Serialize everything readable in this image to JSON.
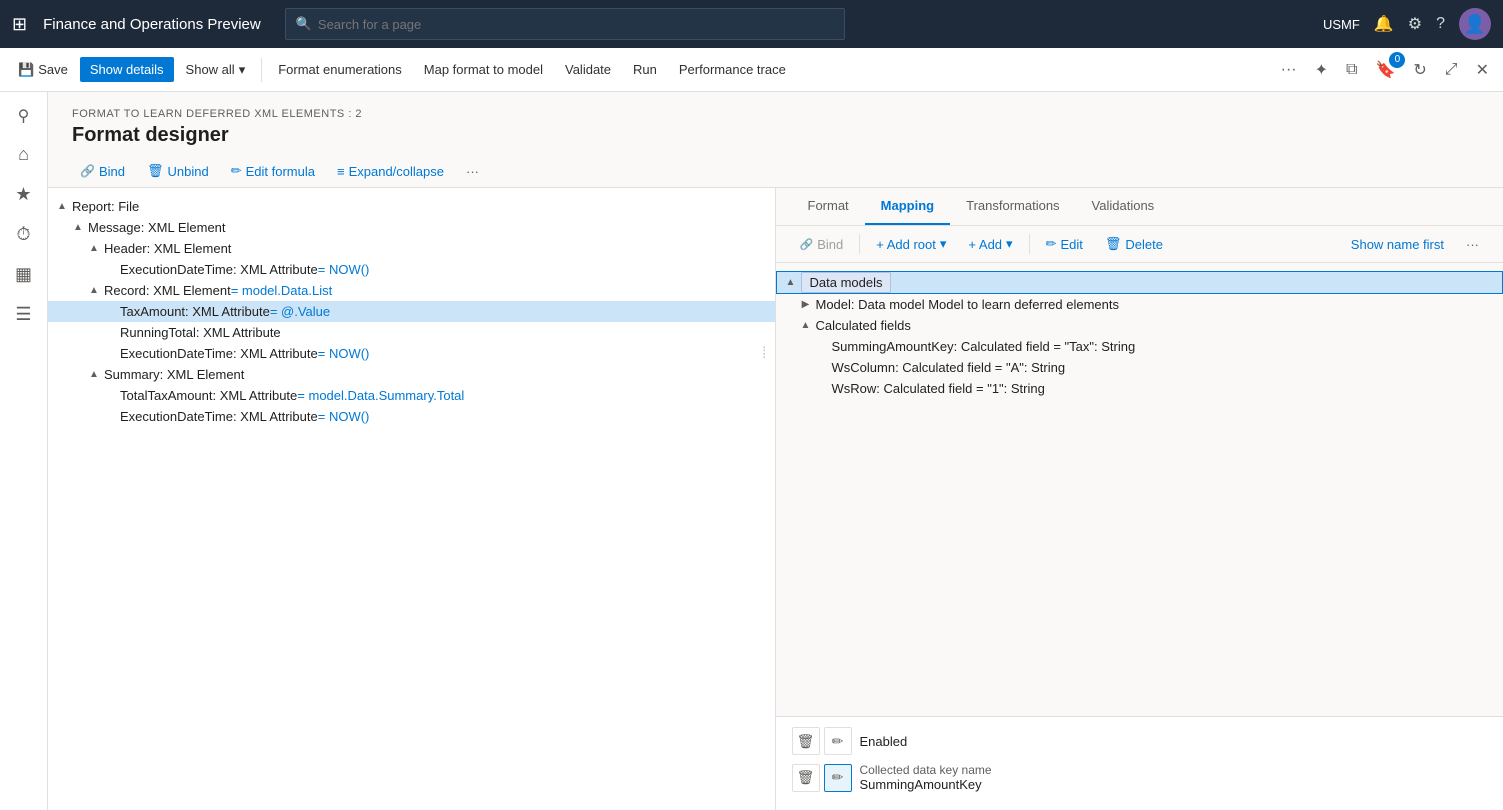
{
  "topNav": {
    "gridIcon": "⊞",
    "appTitle": "Finance and Operations Preview",
    "searchPlaceholder": "Search for a page",
    "searchIcon": "🔍",
    "username": "USMF",
    "bellIcon": "🔔",
    "gearIcon": "⚙",
    "helpIcon": "?",
    "avatarInitial": "👤"
  },
  "toolbar": {
    "saveLabel": "Save",
    "showDetailsLabel": "Show details",
    "showAllLabel": "Show all",
    "showAllDropdown": "▾",
    "formatEnumerationsLabel": "Format enumerations",
    "mapFormatToModelLabel": "Map format to model",
    "validateLabel": "Validate",
    "runLabel": "Run",
    "performanceTraceLabel": "Performance trace",
    "moreIcon": "···",
    "pinIcon": "📌",
    "copyIcon": "⧉",
    "badgeCount": "0",
    "refreshIcon": "↻",
    "popoutIcon": "⤢",
    "closeIcon": "✕"
  },
  "sidebar": {
    "items": [
      {
        "icon": "☰",
        "name": "menu-icon"
      },
      {
        "icon": "⌂",
        "name": "home-icon"
      },
      {
        "icon": "★",
        "name": "favorites-icon"
      },
      {
        "icon": "⏱",
        "name": "recent-icon"
      },
      {
        "icon": "▦",
        "name": "workspaces-icon"
      },
      {
        "icon": "☰",
        "name": "modules-icon"
      }
    ]
  },
  "pageHeader": {
    "breadcrumb": "FORMAT TO LEARN DEFERRED XML ELEMENTS : 2",
    "title": "Format designer"
  },
  "subToolbar": {
    "bindLabel": "Bind",
    "unbindLabel": "Unbind",
    "editFormulaLabel": "Edit formula",
    "expandCollapseLabel": "Expand/collapse",
    "moreIcon": "···"
  },
  "formatTree": {
    "items": [
      {
        "indent": 0,
        "toggle": "▲",
        "label": "Report: File",
        "selected": false
      },
      {
        "indent": 1,
        "toggle": "▲",
        "label": "Message: XML Element",
        "selected": false
      },
      {
        "indent": 2,
        "toggle": "▲",
        "label": "Header: XML Element",
        "selected": false
      },
      {
        "indent": 3,
        "toggle": "",
        "label": "ExecutionDateTime: XML Attribute",
        "formula": " = NOW()",
        "selected": false
      },
      {
        "indent": 2,
        "toggle": "▲",
        "label": "Record: XML Element",
        "formula": " = model.Data.List",
        "selected": false
      },
      {
        "indent": 3,
        "toggle": "",
        "label": "TaxAmount: XML Attribute",
        "formula": " = @.Value",
        "selected": true
      },
      {
        "indent": 3,
        "toggle": "",
        "label": "RunningTotal: XML Attribute",
        "selected": false
      },
      {
        "indent": 3,
        "toggle": "",
        "label": "ExecutionDateTime: XML Attribute",
        "formula": " = NOW()",
        "selected": false,
        "hasHandle": true
      },
      {
        "indent": 2,
        "toggle": "▲",
        "label": "Summary: XML Element",
        "selected": false
      },
      {
        "indent": 3,
        "toggle": "",
        "label": "TotalTaxAmount: XML Attribute",
        "formula": " = model.Data.Summary.Total",
        "selected": false
      },
      {
        "indent": 3,
        "toggle": "",
        "label": "ExecutionDateTime: XML Attribute",
        "formula": " = NOW()",
        "selected": false
      }
    ]
  },
  "rightPanel": {
    "tabs": [
      {
        "label": "Format",
        "active": false
      },
      {
        "label": "Mapping",
        "active": true
      },
      {
        "label": "Transformations",
        "active": false
      },
      {
        "label": "Validations",
        "active": false
      }
    ],
    "subtoolbar": {
      "bindLabel": "Bind",
      "addRootLabel": "+ Add root",
      "addRootDropdown": "▾",
      "addLabel": "+ Add",
      "addDropdown": "▾",
      "editLabel": "Edit",
      "deleteLabel": "Delete",
      "showNameFirstLabel": "Show name first",
      "moreIcon": "···"
    },
    "modelTree": {
      "items": [
        {
          "indent": 0,
          "toggle": "▲",
          "label": "Data models",
          "selected": true,
          "isGroup": true
        },
        {
          "indent": 1,
          "toggle": "▶",
          "label": "Model: Data model Model to learn deferred elements",
          "selected": false
        },
        {
          "indent": 1,
          "toggle": "▲",
          "label": "Calculated fields",
          "selected": false
        },
        {
          "indent": 2,
          "toggle": "",
          "label": "SummingAmountKey: Calculated field = \"Tax\": String",
          "selected": false
        },
        {
          "indent": 2,
          "toggle": "",
          "label": "WsColumn: Calculated field = \"A\": String",
          "selected": false
        },
        {
          "indent": 2,
          "toggle": "",
          "label": "WsRow: Calculated field = \"1\": String",
          "selected": false
        }
      ]
    },
    "bottomFields": [
      {
        "label": "Enabled",
        "hasDelete": true,
        "hasEdit": true
      },
      {
        "sublabel": "Collected data key name",
        "value": "SummingAmountKey",
        "hasDelete": true,
        "hasEdit": true,
        "editActive": true
      }
    ]
  }
}
